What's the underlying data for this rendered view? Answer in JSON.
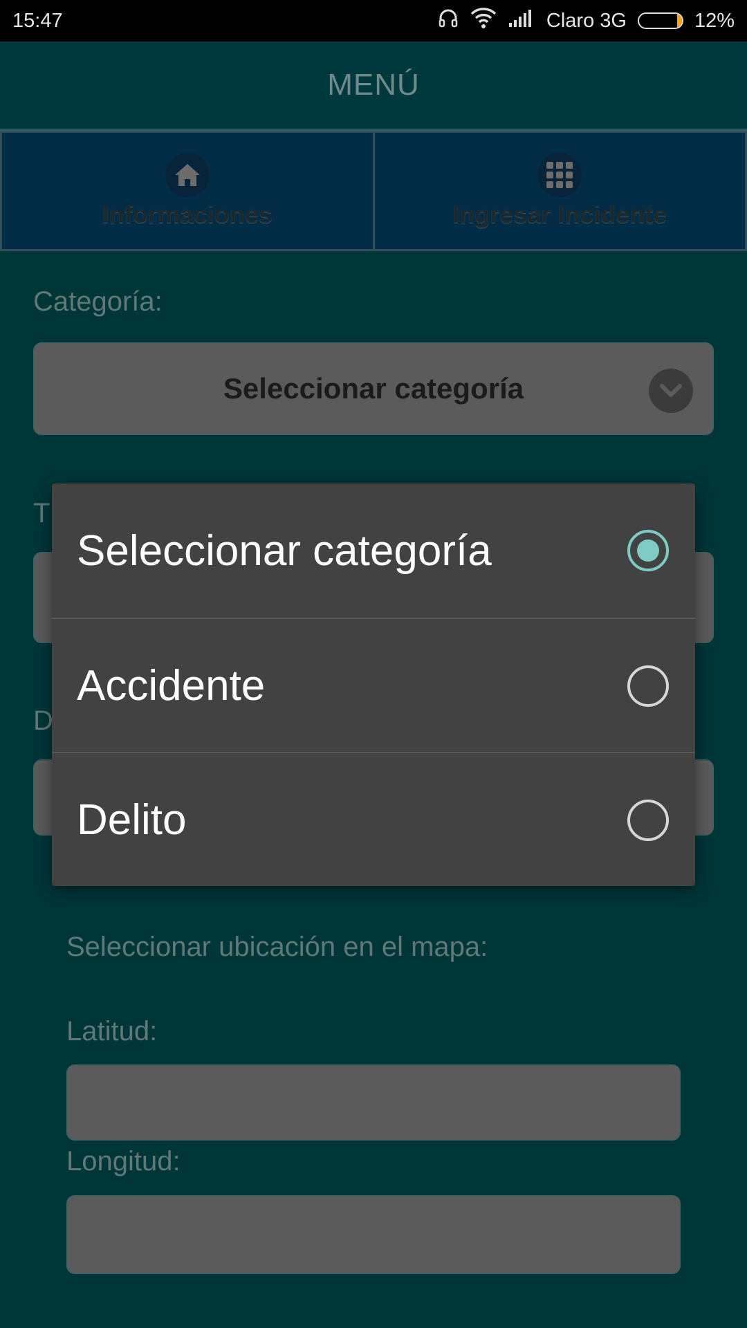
{
  "status_bar": {
    "time": "15:47",
    "carrier": "Claro 3G",
    "battery_percent": "12%",
    "battery_level": 0.12,
    "icons": [
      "headset-icon",
      "wifi-icon",
      "signal-icon",
      "battery-icon"
    ]
  },
  "header": {
    "title": "MENÚ"
  },
  "tabs": [
    {
      "label": "Informaciones",
      "icon": "home-icon"
    },
    {
      "label": "Ingresar Incidente",
      "icon": "grid-icon"
    }
  ],
  "form": {
    "category_label": "Categoría:",
    "category_select_value": "Seleccionar categoría",
    "partial_label_1": "T",
    "partial_label_2": "D",
    "map_location_label": "Seleccionar ubicación en el mapa:",
    "latitude_label": "Latitud:",
    "longitude_label": "Longitud:"
  },
  "dialog": {
    "options": [
      {
        "label": "Seleccionar categoría",
        "selected": true
      },
      {
        "label": "Accidente",
        "selected": false
      },
      {
        "label": "Delito",
        "selected": false
      }
    ]
  },
  "colors": {
    "background": "#003638",
    "tab_background": "#032c46",
    "dialog_background": "#424242",
    "radio_accent": "#80cbc4",
    "battery_fill": "#f6a21e"
  }
}
